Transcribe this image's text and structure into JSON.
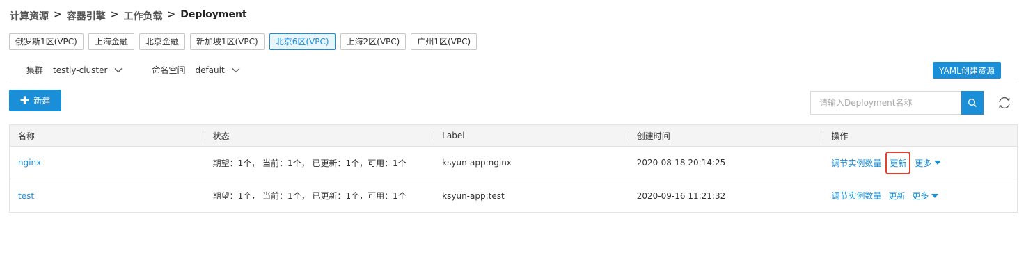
{
  "breadcrumb": {
    "items": [
      "计算资源",
      "容器引擎",
      "工作负载",
      "Deployment"
    ],
    "separator": ">"
  },
  "regions": [
    {
      "label": "俄罗斯1区(VPC)",
      "active": false
    },
    {
      "label": "上海金融",
      "active": false
    },
    {
      "label": "北京金融",
      "active": false
    },
    {
      "label": "新加坡1区(VPC)",
      "active": false
    },
    {
      "label": "北京6区(VPC)",
      "active": true
    },
    {
      "label": "上海2区(VPC)",
      "active": false
    },
    {
      "label": "广州1区(VPC)",
      "active": false
    }
  ],
  "filters": {
    "cluster_label": "集群",
    "cluster_value": "testly-cluster",
    "namespace_label": "命名空间",
    "namespace_value": "default"
  },
  "toolbar": {
    "yaml_button": "YAML创建资源",
    "new_button": "新建",
    "search_placeholder": "请输入Deployment名称"
  },
  "table": {
    "headers": [
      "名称",
      "状态",
      "Label",
      "创建时间",
      "操作"
    ],
    "rows": [
      {
        "name": "nginx",
        "status": "期望：1个， 当前：1个， 已更新：1个，可用：1个",
        "label": "ksyun-app:nginx",
        "created": "2020-08-18 20:14:25",
        "op_scale": "调节实例数量",
        "op_update": "更新",
        "op_more": "更多"
      },
      {
        "name": "test",
        "status": "期望：1个， 当前：1个， 已更新：1个，可用：1个",
        "label": "ksyun-app:test",
        "created": "2020-09-16 11:21:32",
        "op_scale": "调节实例数量",
        "op_update": "更新",
        "op_more": "更多"
      }
    ]
  },
  "colors": {
    "accent": "#1a8fd8",
    "highlight": "#e0412f"
  }
}
